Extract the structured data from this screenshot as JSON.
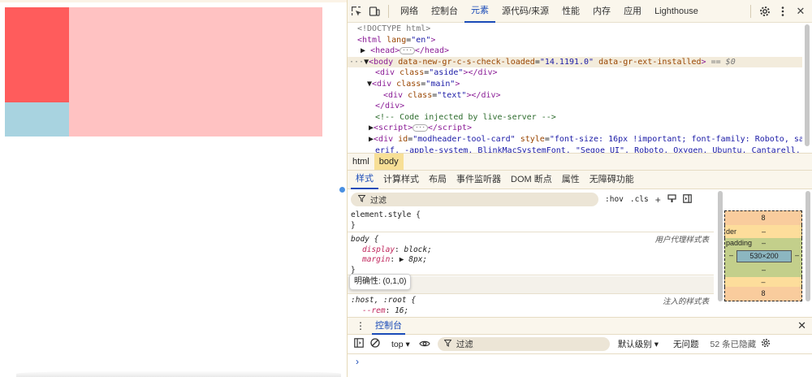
{
  "toolbar": {
    "tabs": [
      "网络",
      "控制台",
      "元素",
      "源代码/来源",
      "性能",
      "内存",
      "应用",
      "Lighthouse"
    ],
    "active_tab": "元素"
  },
  "tree": {
    "lines": [
      {
        "text": "<!DOCTYPE html>"
      },
      {
        "open": "<html",
        "attrs": [
          {
            "n": "lang",
            "v": "\"en\""
          }
        ],
        "close": ">"
      },
      {
        "tag": "head"
      },
      {
        "body_line": true,
        "open": "<body",
        "attrs": [
          {
            "n": "data-new-gr-c-s-check-loaded",
            "v": "\"14.1191.0\""
          },
          {
            "n": "data-gr-ext-installed",
            "v": ""
          }
        ],
        "suffix": "== $0"
      },
      {
        "div": "aside"
      },
      {
        "div_open": "main"
      },
      {
        "div": "text"
      },
      {
        "close_div": true
      },
      {
        "comment": "<!-- Code injected by live-server -->"
      },
      {
        "script": true
      },
      {
        "modheader1": "<div id=\"modheader-tool-card\" style=\"font-size: 16px !important; font-family: Roboto, sans-s",
        "modheader2": "erif, -apple-system, BlinkMacSystemFont, \"Segoe UI\", Roboto, Oxygen, Ubuntu, Cantarell, \"Fir"
      }
    ]
  },
  "breadcrumbs": [
    "html",
    "body"
  ],
  "subtabs": [
    "样式",
    "计算样式",
    "布局",
    "事件监听器",
    "DOM 断点",
    "属性",
    "无障碍功能"
  ],
  "styles": {
    "filter_placeholder": "过滤",
    "hov": ":hov",
    "cls": ".cls",
    "rule1_selector": "element.style {",
    "rule1_close": "}",
    "rule2_selector": "body {",
    "rule2_source": "用户代理样式表",
    "rule2_prop1": "display",
    "rule2_val1": "block;",
    "rule2_prop2": "margin",
    "rule2_val2": "8px;",
    "rule2_close": "}",
    "tooltip": "明确性: (0,1,0)",
    "rule3_selector": ":host, :root {",
    "rule3_source": "注入的样式表",
    "rule3_prop1": "--rem",
    "rule3_val1": "16;"
  },
  "boxmodel": {
    "margin_top": "8",
    "border_label": "der",
    "border_val": "–",
    "padding_label": "padding",
    "padding_val": "–",
    "content": "530×200",
    "dash": "–",
    "margin_bottom": "8"
  },
  "drawer": {
    "tab": "控制台",
    "context": "top",
    "filter_placeholder": "过滤",
    "levels": "默认级别",
    "no_issues": "无问题",
    "hidden": "52 条已隐藏",
    "prompt": "›"
  }
}
